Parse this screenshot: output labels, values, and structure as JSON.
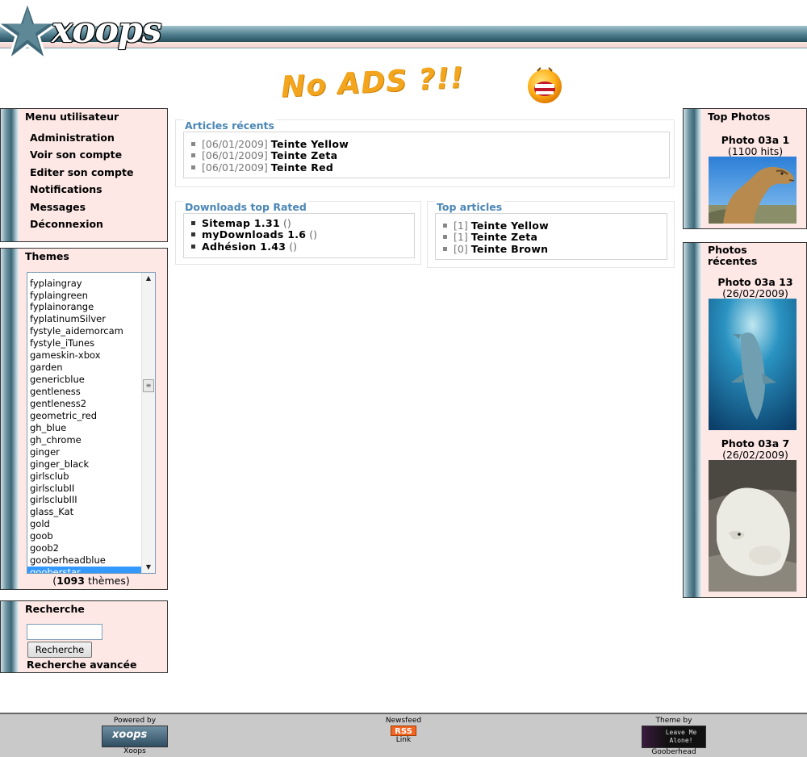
{
  "header": {
    "logo_text": "xoops",
    "banner_text": "No ADS ?!!"
  },
  "user_menu": {
    "title": "Menu utilisateur",
    "items": [
      "Administration",
      "Voir son compte",
      "Editer son compte",
      "Notifications",
      "Messages",
      "Déconnexion"
    ]
  },
  "themes": {
    "title": "Themes",
    "options": [
      "fyplaingray",
      "fyplaingreen",
      "fyplainorange",
      "fyplatinumSilver",
      "fystyle_aidemorcam",
      "fystyle_iTunes",
      "gameskin-xbox",
      "garden",
      "genericblue",
      "gentleness",
      "gentleness2",
      "geometric_red",
      "gh_blue",
      "gh_chrome",
      "ginger",
      "ginger_black",
      "girlsclub",
      "girlsclubII",
      "girlsclubIII",
      "glass_Kat",
      "gold",
      "goob",
      "goob2",
      "gooberheadblue",
      "gooberstar"
    ],
    "selected": "gooberstar",
    "count": "1093",
    "count_label": "thèmes"
  },
  "search": {
    "title": "Recherche",
    "input_value": "",
    "button_label": "Recherche",
    "advanced_label": "Recherche avancée"
  },
  "recent_articles": {
    "title": "Articles récents",
    "items": [
      {
        "date": "[06/01/2009]",
        "title": "Teinte Yellow"
      },
      {
        "date": "[06/01/2009]",
        "title": "Teinte Zeta"
      },
      {
        "date": "[06/01/2009]",
        "title": "Teinte Red"
      }
    ]
  },
  "downloads_top": {
    "title": "Downloads top Rated",
    "items": [
      {
        "title": "Sitemap 1.31",
        "extra": "()"
      },
      {
        "title": "myDownloads 1.6",
        "extra": "()"
      },
      {
        "title": "Adhésion 1.43",
        "extra": "()"
      }
    ]
  },
  "top_articles": {
    "title": "Top articles",
    "items": [
      {
        "count": "[1]",
        "title": "Teinte Yellow"
      },
      {
        "count": "[1]",
        "title": "Teinte Zeta"
      },
      {
        "count": "[0]",
        "title": "Teinte Brown"
      }
    ]
  },
  "top_photos": {
    "title": "Top Photos",
    "photos": [
      {
        "title": "Photo 03a 1",
        "sub": "(1100 hits)",
        "image": "camel"
      }
    ]
  },
  "recent_photos": {
    "title": "Photos récentes",
    "photos": [
      {
        "title": "Photo 03a 13",
        "sub": "(26/02/2009)",
        "image": "dolphin"
      },
      {
        "title": "Photo 03a 7",
        "sub": "(26/02/2009)",
        "image": "polar-bear"
      }
    ]
  },
  "footer": {
    "powered_by": "Powered by",
    "powered_name": "Xoops",
    "powered_badge": "xoops",
    "newsfeed": "Newsfeed",
    "rss": "RSS",
    "link": "Link",
    "theme_by": "Theme by",
    "theme_author": "Gooberhead",
    "theme_badge": "Leave Me Alone!"
  },
  "colors": {
    "block_bg": "#fde8e6",
    "legend_blue": "#4a86b5",
    "select_highlight": "#3399ff"
  }
}
